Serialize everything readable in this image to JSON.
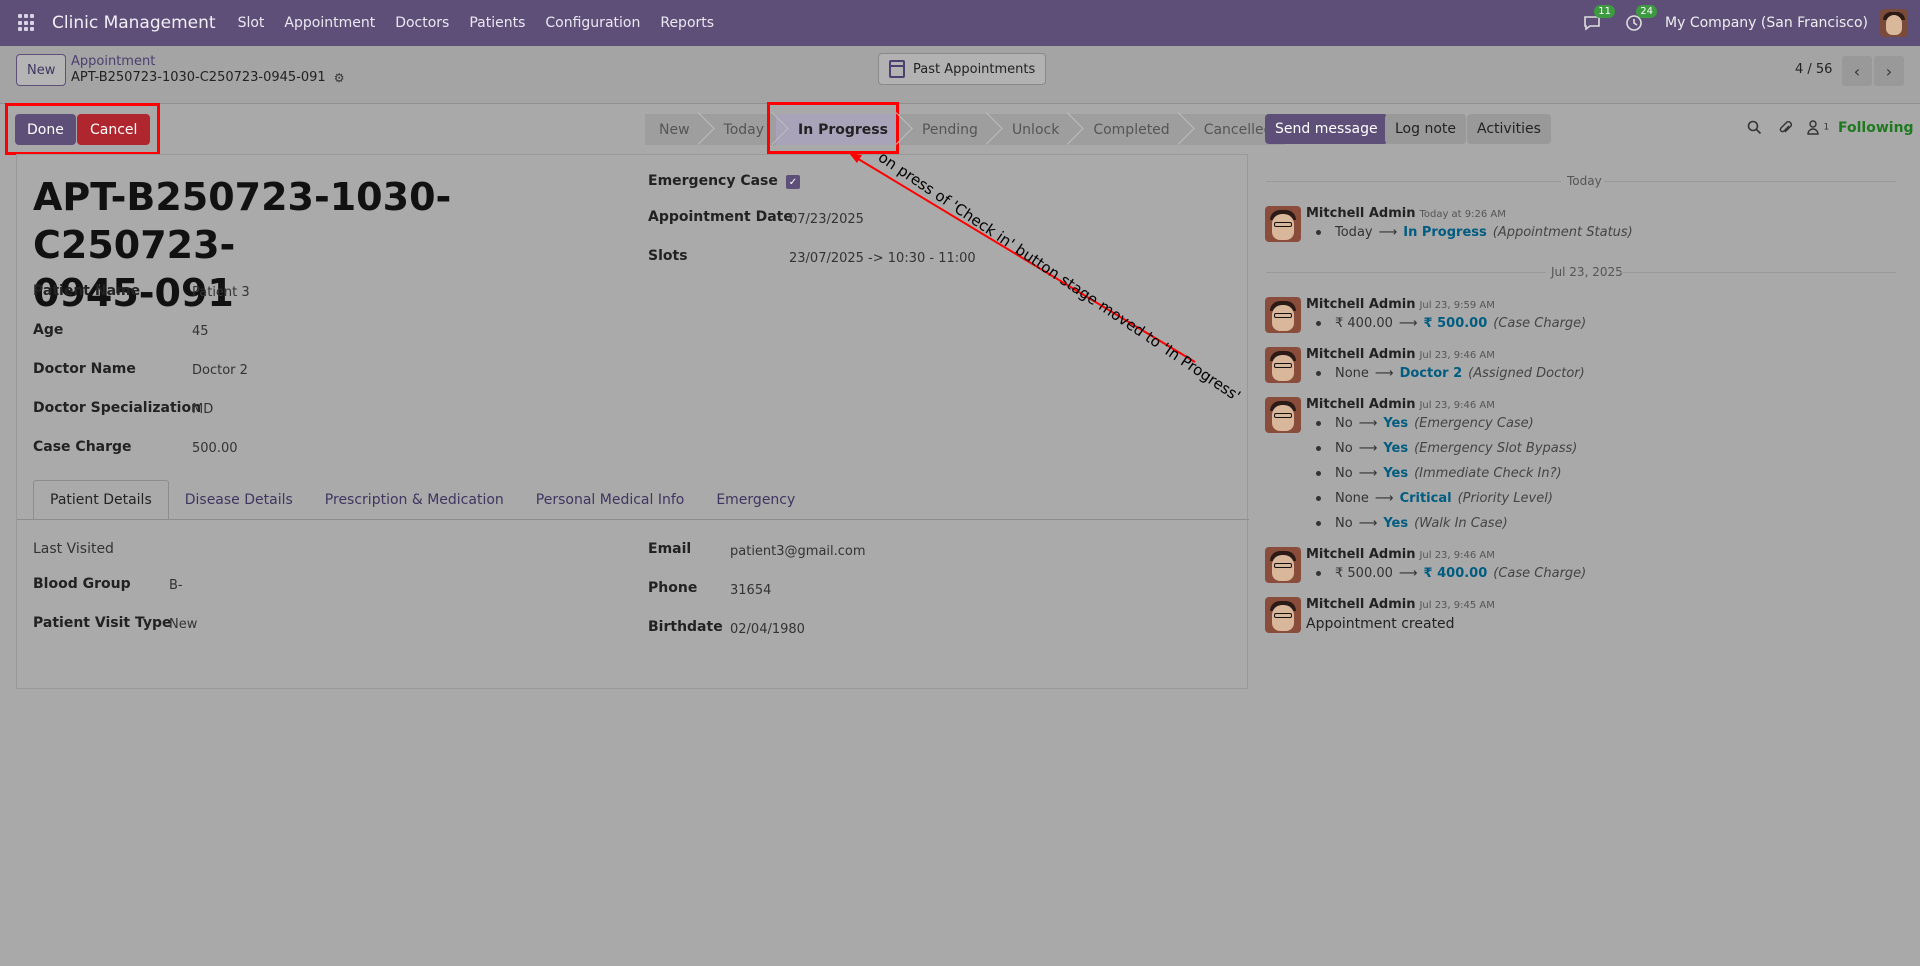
{
  "navbar": {
    "app_title": "Clinic Management",
    "menu": [
      "Slot",
      "Appointment",
      "Doctors",
      "Patients",
      "Configuration",
      "Reports"
    ],
    "messages_count": "11",
    "activities_count": "24",
    "company": "My Company (San Francisco)"
  },
  "control_panel": {
    "new_label": "New",
    "breadcrumb_parent": "Appointment",
    "breadcrumb_current": "APT-B250723-1030-C250723-0945-091",
    "past_appointments_label": "Past Appointments",
    "pager": "4 / 56"
  },
  "actions": {
    "done_label": "Done",
    "cancel_label": "Cancel"
  },
  "stages": [
    "New",
    "Today",
    "In Progress",
    "Pending",
    "Unlock",
    "Completed",
    "Cancelled"
  ],
  "active_stage": "In Progress",
  "chatter_header": {
    "send_message": "Send message",
    "log_note": "Log note",
    "activities": "Activities",
    "followers_count": "1",
    "following": "Following"
  },
  "form": {
    "title_line1": "APT-B250723-1030-C250723-",
    "title_line2": "0945-091",
    "patient_name_label": "Patient Name",
    "patient_name": "Patient 3",
    "age_label": "Age",
    "age": "45",
    "doctor_name_label": "Doctor Name",
    "doctor_name": "Doctor 2",
    "doctor_spec_label": "Doctor Specialization",
    "doctor_spec": "MD",
    "case_charge_label": "Case Charge",
    "case_charge": "500.00",
    "emergency_case_label": "Emergency Case",
    "emergency_case_checked": true,
    "appointment_date_label": "Appointment Date",
    "appointment_date": "07/23/2025",
    "slots_label": "Slots",
    "slots": "23/07/2025 -> 10:30 - 11:00"
  },
  "tabs": [
    "Patient Details",
    "Disease Details",
    "Prescription & Medication",
    "Personal Medical Info",
    "Emergency"
  ],
  "patient_details": {
    "last_visited_label": "Last Visited",
    "blood_group_label": "Blood Group",
    "blood_group": "B-",
    "visit_type_label": "Patient Visit Type",
    "visit_type": "New",
    "email_label": "Email",
    "email": "patient3@gmail.com",
    "phone_label": "Phone",
    "phone": "31654",
    "birthdate_label": "Birthdate",
    "birthdate": "02/04/1980"
  },
  "chatter": {
    "sep_today": "Today",
    "sep_jul": "Jul 23, 2025",
    "arrow": "⟶",
    "messages": [
      {
        "author": "Mitchell Admin",
        "time": "Today at 9:26 AM",
        "changes": [
          {
            "old": "Today",
            "new": "In Progress",
            "field": "(Appointment Status)"
          }
        ]
      },
      {
        "author": "Mitchell Admin",
        "time": "Jul 23, 9:59 AM",
        "changes": [
          {
            "old": "₹ 400.00",
            "new": "₹ 500.00",
            "field": "(Case Charge)"
          }
        ]
      },
      {
        "author": "Mitchell Admin",
        "time": "Jul 23, 9:46 AM",
        "changes": [
          {
            "old": "None",
            "new": "Doctor 2",
            "field": "(Assigned Doctor)"
          }
        ]
      },
      {
        "author": "Mitchell Admin",
        "time": "Jul 23, 9:46 AM",
        "changes": [
          {
            "old": "No",
            "new": "Yes",
            "field": "(Emergency Case)"
          },
          {
            "old": "No",
            "new": "Yes",
            "field": "(Emergency Slot Bypass)"
          },
          {
            "old": "No",
            "new": "Yes",
            "field": "(Immediate Check In?)"
          },
          {
            "old": "None",
            "new": "Critical",
            "field": "(Priority Level)"
          },
          {
            "old": "No",
            "new": "Yes",
            "field": "(Walk In Case)"
          }
        ]
      },
      {
        "author": "Mitchell Admin",
        "time": "Jul 23, 9:46 AM",
        "changes": [
          {
            "old": "₹ 500.00",
            "new": "₹ 400.00",
            "field": "(Case Charge)"
          }
        ]
      },
      {
        "author": "Mitchell Admin",
        "time": "Jul 23, 9:45 AM",
        "body": "Appointment created"
      }
    ]
  },
  "annotation": {
    "text": "on press of 'Check in' button stage moved to 'In Progress'",
    "color": "#ff0000"
  },
  "colors": {
    "brand": "#5e4f79",
    "danger": "#b0262e",
    "following": "#1f7a1f",
    "link_value": "#005c80"
  }
}
